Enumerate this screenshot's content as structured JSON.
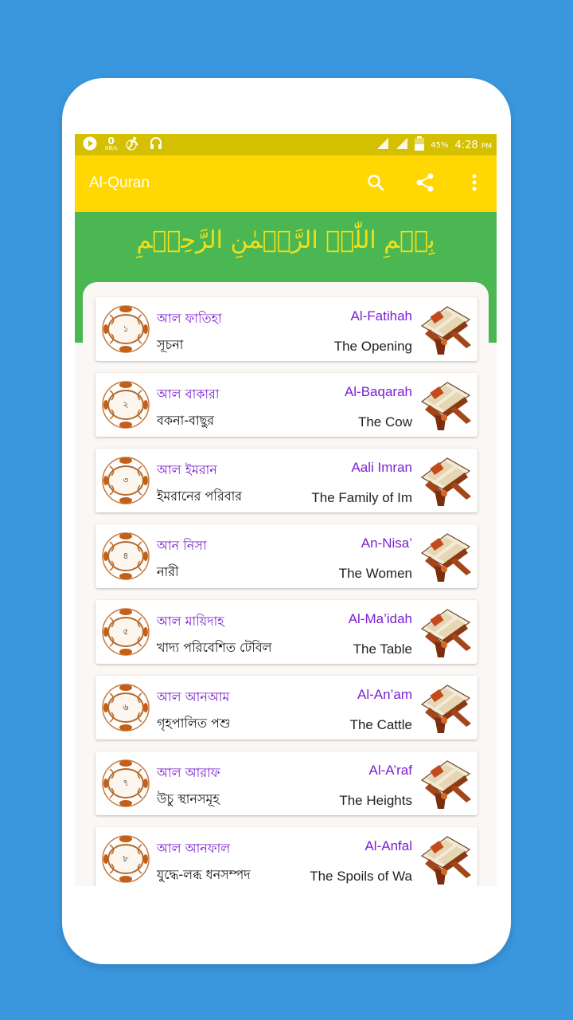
{
  "status_bar": {
    "net_speed": "0",
    "net_unit": "KB/s",
    "battery": "45%",
    "time": "4:28",
    "ampm": "PM"
  },
  "app_bar": {
    "title": "Al-Quran",
    "actions": [
      "search-icon",
      "share-icon",
      "more-vert-icon"
    ]
  },
  "banner": {
    "bismillah": "بِسۡمِ اللّٰہِ الرَّحۡمٰنِ الرَّحِیۡمِ"
  },
  "colors": {
    "background": "#3a97de",
    "app_bar": "#ffd803",
    "status_bar": "#d4c000",
    "banner": "#4ab753",
    "accent_purple": "#7b1fd1",
    "bismillah": "#f2df1a"
  },
  "surahs": [
    {
      "number": "১",
      "bn_name": "আল ফাতিহা",
      "bn_meaning": "সূচনা",
      "en_name": "Al-Fatihah",
      "en_meaning": "The Opening"
    },
    {
      "number": "২",
      "bn_name": "আল বাকারা",
      "bn_meaning": "বকনা-বাছুর",
      "en_name": "Al-Baqarah",
      "en_meaning": "The Cow"
    },
    {
      "number": "৩",
      "bn_name": "আল ইমরান",
      "bn_meaning": "ইমরানের পরিবার",
      "en_name": "Aali Imran",
      "en_meaning": "The Family of Im"
    },
    {
      "number": "৪",
      "bn_name": "আন নিসা",
      "bn_meaning": "নারী",
      "en_name": "An-Nisa’",
      "en_meaning": "The Women"
    },
    {
      "number": "৫",
      "bn_name": "আল মায়িদাহ",
      "bn_meaning": "খাদ্য পরিবেশিত টেবিল",
      "en_name": "Al-Ma’idah",
      "en_meaning": "The Table"
    },
    {
      "number": "৬",
      "bn_name": "আল আনআম",
      "bn_meaning": "গৃহপালিত পশু",
      "en_name": "Al-An’am",
      "en_meaning": "The Cattle"
    },
    {
      "number": "৭",
      "bn_name": "আল আরাফ",
      "bn_meaning": "উচু স্থানসমূহ",
      "en_name": "Al-A’raf",
      "en_meaning": "The Heights"
    },
    {
      "number": "৮",
      "bn_name": "আল আনফাল",
      "bn_meaning": "যুদ্ধে-লব্ধ ধনসম্পদ",
      "en_name": "Al-Anfal",
      "en_meaning": "The Spoils of Wa"
    }
  ]
}
